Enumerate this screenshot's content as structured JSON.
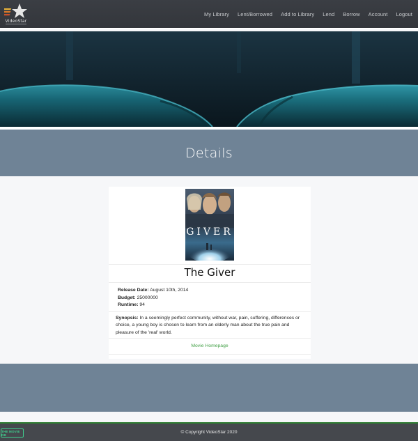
{
  "app": {
    "brand": "VideoStar"
  },
  "nav": {
    "items": [
      {
        "label": "My Library"
      },
      {
        "label": "Lent/Borrowed"
      },
      {
        "label": "Add to Library"
      },
      {
        "label": "Lend"
      },
      {
        "label": "Borrow"
      },
      {
        "label": "Account"
      },
      {
        "label": "Logout"
      }
    ]
  },
  "page": {
    "heading": "Details"
  },
  "movie": {
    "poster_text": "GIVER",
    "title": "The Giver",
    "release_label": "Release Date:",
    "release_value": "August 10th, 2014",
    "budget_label": "Budget:",
    "budget_value": "25000000",
    "runtime_label": "Runtime:",
    "runtime_value": "94",
    "synopsis_label": "Synopsis:",
    "synopsis_text": "In a seemingly perfect community, without war, pain, suffering, differences or choice, a young boy is chosen to learn from an elderly man about the true pain and pleasure of the 'real' world.",
    "homepage_link": "Movie Homepage"
  },
  "footer": {
    "copyright": "© Copyright VideoStar 2020",
    "badge": "THE MOVIE DB"
  },
  "colors": {
    "navbar": "#3b3e44",
    "band": "#6f8396",
    "link_green": "#43a047",
    "footer": "#45484d",
    "footer_accent": "#2e7d32",
    "tmdb_green": "#3fcf8e"
  }
}
